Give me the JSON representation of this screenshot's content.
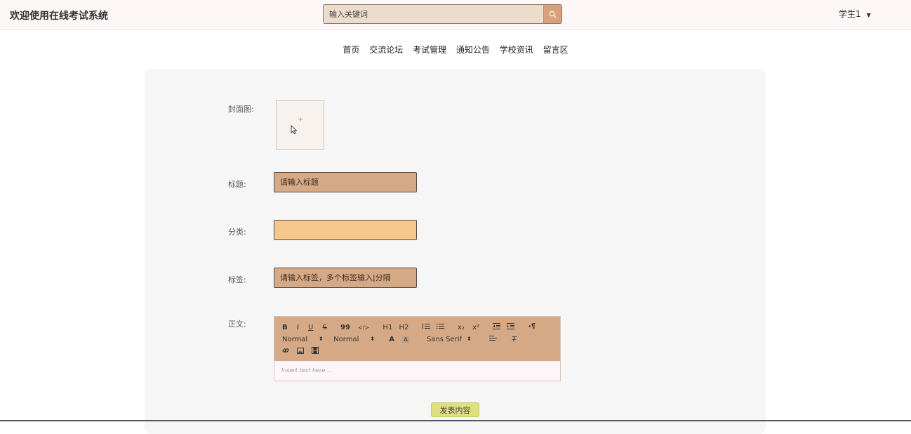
{
  "header": {
    "site_title": "欢迎使用在线考试系统",
    "search_placeholder": "输入关键词",
    "user_name": "学生1"
  },
  "nav": {
    "items": [
      "首页",
      "交流论坛",
      "考试管理",
      "通知公告",
      "学校资讯",
      "留言区"
    ]
  },
  "form": {
    "cover_label": "封面图:",
    "cover_plus": "+",
    "title_label": "标题:",
    "title_placeholder": "请输入标题",
    "category_label": "分类:",
    "category_value": "",
    "tags_label": "标签:",
    "tags_placeholder": "请输入标签，多个标签输入|分隔",
    "body_label": "正文:",
    "submit_label": "发表内容"
  },
  "editor": {
    "row1": [
      "B",
      "I",
      "U",
      "S",
      "99",
      "</>",
      "H1",
      "H2",
      "ol",
      "ul",
      "x₂",
      "x²",
      "indent-out",
      "indent-in",
      "rtl"
    ],
    "size_select": "Normal",
    "header_select": "Normal",
    "font_select": "Sans Serif",
    "placeholder": "Insert text here ..."
  },
  "colors": {
    "accent_brown": "#d5a985",
    "accent_orange": "#f6c78d",
    "submit_yellow": "#dfdf80",
    "topbar_bg": "#fdf7f7"
  }
}
